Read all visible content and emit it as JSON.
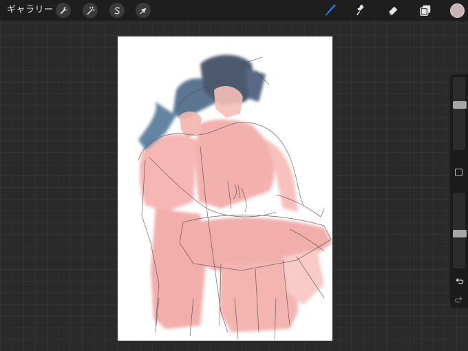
{
  "topbar": {
    "gallery_label": "ギャラリー",
    "left_tools": [
      {
        "name": "actions",
        "icon": "wrench-icon"
      },
      {
        "name": "adjustments",
        "icon": "magic-wand-icon"
      },
      {
        "name": "selection",
        "icon": "selection-s-icon"
      },
      {
        "name": "transform",
        "icon": "arrow-cursor-icon"
      }
    ],
    "right_tools": [
      {
        "name": "brush",
        "icon": "brush-icon",
        "active": true
      },
      {
        "name": "smudge",
        "icon": "smudge-icon",
        "active": false
      },
      {
        "name": "eraser",
        "icon": "eraser-icon",
        "active": false
      },
      {
        "name": "layers",
        "icon": "layers-icon",
        "active": false
      }
    ],
    "current_color": "#c9b3b6",
    "accent_color": "#1f7ff0"
  },
  "sidebar": {
    "brush_size_level": 0.63,
    "opacity_level": 0.45,
    "modify_icon": "square-modify-icon",
    "undo_icon": "undo-icon",
    "redo_icon": "redo-icon"
  },
  "canvas": {
    "background": "#ffffff",
    "artwork": "sketch-illustration"
  }
}
